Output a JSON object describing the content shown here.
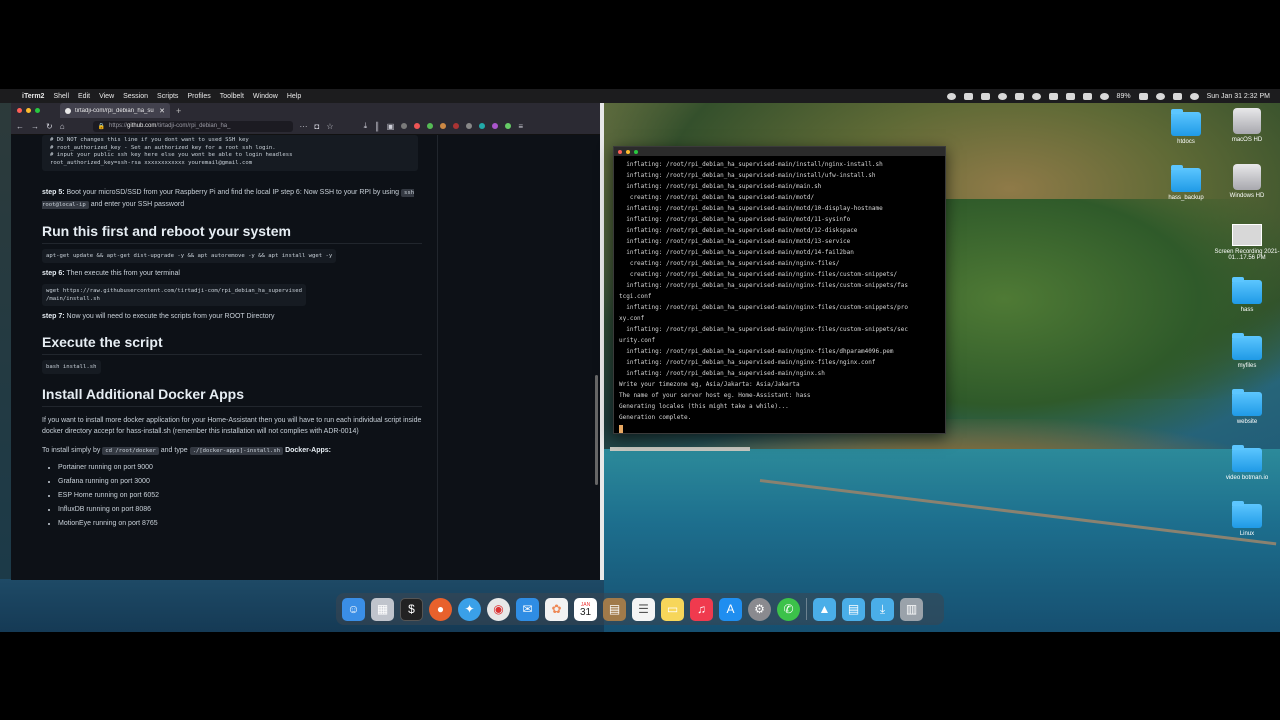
{
  "menubar": {
    "app": "iTerm2",
    "items": [
      "Shell",
      "Edit",
      "View",
      "Session",
      "Scripts",
      "Profiles",
      "Toolbelt",
      "Window",
      "Help"
    ],
    "battery": "89%",
    "datetime": "Sun Jan 31  2:32 PM"
  },
  "browser": {
    "tab_title": "tirtadji-com/rpi_debian_ha_su",
    "url_prefix": "https://",
    "url_host": "github.com",
    "url_path": "/tirtadji-com/rpi_debian_ha_"
  },
  "article": {
    "top_code": "# DO NOT changes this line if you dont want to used SSH key\n# root_authorized_key - Set an authorized key for a root ssh login.\n# input your public ssh key here else you wont be able to login headless\nroot_authorized_key=ssh-rsa xxxxxxxxxxxx youremail@gmail.com",
    "step5_label": "step 5:",
    "step5_text": " Boot your microSD/SSD from your Raspberry Pi and find the local IP step 6: Now SSH to your RPI by using ",
    "step5_code": "ssh root@local-ip",
    "step5_text2": " and enter your SSH password",
    "h_run": "Run this first and reboot your system",
    "run_code": "apt-get update && apt-get dist-upgrade -y && apt autoremove -y && apt install wget -y",
    "step6_label": "step 6:",
    "step6_text": " Then execute this from your terminal",
    "wget_code": "wget https://raw.githubusercontent.com/tirtadji-com/rpi_debian_ha_supervised\n/main/install.sh",
    "step7_label": "step 7:",
    "step7_text": " Now you will need to execute the scripts from your ROOT Directory",
    "h_exec": "Execute the script",
    "bash_code": "bash install.sh",
    "h_docker": "Install Additional Docker Apps",
    "docker_para": "If you want to install more docker application for your Home-Assistant then you will have to run each individual script inside docker directory accept for hass-install.sh (remember this installation will not complies with ADR-0014)",
    "install_text": "To install simply by ",
    "install_code1": "cd /root/docker",
    "install_and": " and type ",
    "install_code2": "./[docker-apps]-install.sh",
    "install_bold": " Docker-Apps:",
    "apps": [
      "Portainer running on port 9000",
      "Grafana running on port 3000",
      "ESP Home running on port 6052",
      "InfluxDB running on port 8086",
      "MotionEye running on port 8765"
    ]
  },
  "terminal": {
    "lines": [
      "  inflating: /root/rpi_debian_ha_supervised-main/install/nginx-install.sh",
      "  inflating: /root/rpi_debian_ha_supervised-main/install/ufw-install.sh",
      "  inflating: /root/rpi_debian_ha_supervised-main/main.sh",
      "   creating: /root/rpi_debian_ha_supervised-main/motd/",
      "  inflating: /root/rpi_debian_ha_supervised-main/motd/10-display-hostname",
      "  inflating: /root/rpi_debian_ha_supervised-main/motd/11-sysinfo",
      "  inflating: /root/rpi_debian_ha_supervised-main/motd/12-diskspace",
      "  inflating: /root/rpi_debian_ha_supervised-main/motd/13-service",
      "  inflating: /root/rpi_debian_ha_supervised-main/motd/14-fail2ban",
      "   creating: /root/rpi_debian_ha_supervised-main/nginx-files/",
      "   creating: /root/rpi_debian_ha_supervised-main/nginx-files/custom-snippets/",
      "  inflating: /root/rpi_debian_ha_supervised-main/nginx-files/custom-snippets/fas",
      "tcgi.conf",
      "  inflating: /root/rpi_debian_ha_supervised-main/nginx-files/custom-snippets/pro",
      "xy.conf",
      "  inflating: /root/rpi_debian_ha_supervised-main/nginx-files/custom-snippets/sec",
      "urity.conf",
      "  inflating: /root/rpi_debian_ha_supervised-main/nginx-files/dhparam4096.pem",
      "  inflating: /root/rpi_debian_ha_supervised-main/nginx-files/nginx.conf",
      "  inflating: /root/rpi_debian_ha_supervised-main/nginx.sh",
      "Write your timezone eg, Asia/Jakarta: Asia/Jakarta",
      "The name of your server host eg. Home-Assistant: hass",
      "Generating locales (this might take a while)...",
      "Generation complete."
    ]
  },
  "desktop_icons": [
    "htdocs",
    "macOS HD",
    "hass_backup",
    "Windows HD",
    "Screen Recording 2021-01...17.56 PM",
    "hass",
    "myfiles",
    "website",
    "video botman.io",
    "Linux"
  ],
  "dock": {
    "calendar_month": "JAN",
    "calendar_day": "31"
  }
}
